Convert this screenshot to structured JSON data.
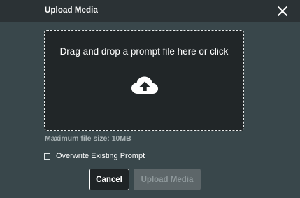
{
  "dialog": {
    "title": "Upload Media",
    "close_icon": "close-icon"
  },
  "dropzone": {
    "text": "Drag and drop a prompt file here or click",
    "icon": "cloud-upload-icon"
  },
  "max_file_size": "Maximum file size: 10MB",
  "overwrite": {
    "label": "Overwrite Existing Prompt",
    "checked": false
  },
  "buttons": {
    "cancel": "Cancel",
    "upload": "Upload Media",
    "upload_disabled": true
  },
  "colors": {
    "background": "#39474b",
    "header": "#2b3235",
    "dropzone": "#212628",
    "disabled_button": "#5d6669"
  }
}
